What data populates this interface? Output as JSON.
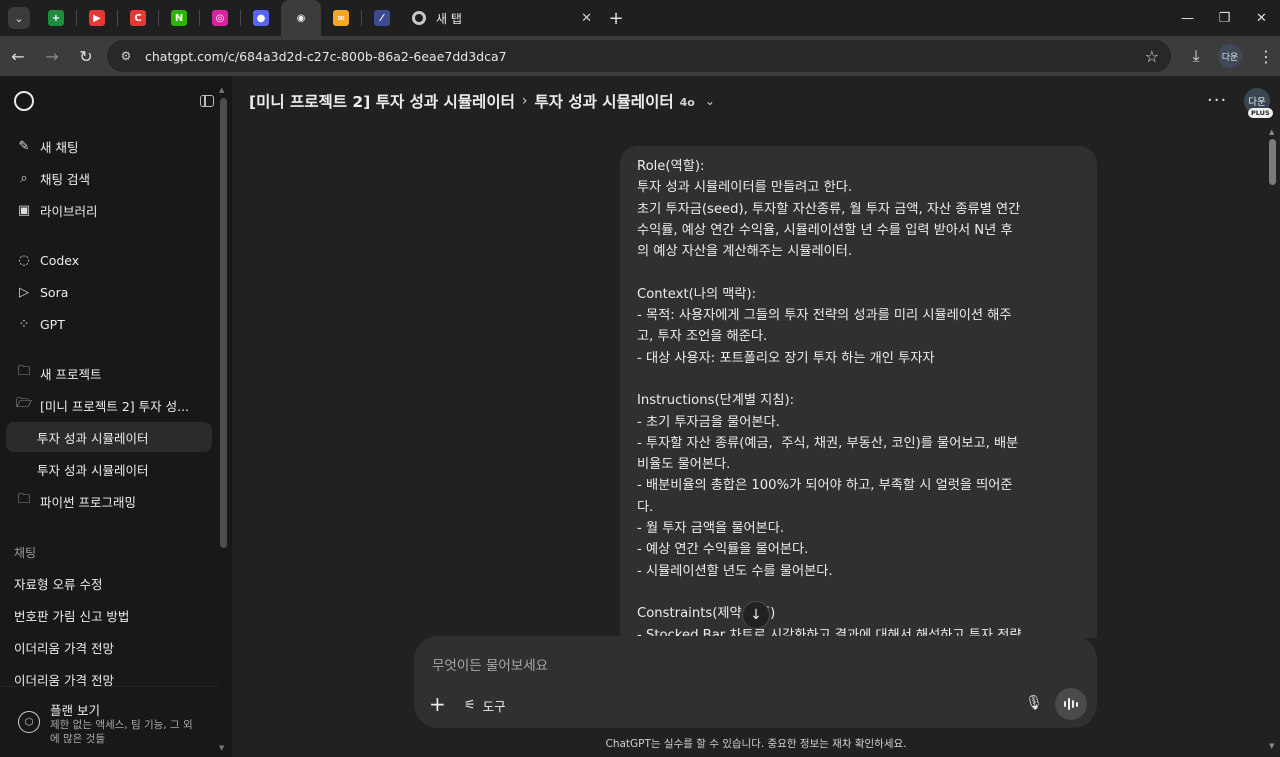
{
  "browser": {
    "tabs": [
      {
        "icon": "sheets-tab-icon",
        "glyph": "+",
        "color": "#1e8e3e"
      },
      {
        "icon": "youtube-tab-icon",
        "glyph": "▶",
        "color": "#e53935"
      },
      {
        "icon": "c-app-tab-icon",
        "glyph": "C",
        "color": "#e53935"
      },
      {
        "icon": "naver-tab-icon",
        "glyph": "N",
        "color": "#2db400"
      },
      {
        "icon": "instagram-tab-icon",
        "glyph": "◎",
        "color": "#d6249f"
      },
      {
        "icon": "discord-tab-icon",
        "glyph": "●",
        "color": "#5865f2"
      },
      {
        "icon": "chatgpt-tab-icon",
        "glyph": "◉",
        "color": "#3c3c3c"
      },
      {
        "icon": "infinity-tab-icon",
        "glyph": "∞",
        "color": "#f5a623"
      },
      {
        "icon": "feather-tab-icon",
        "glyph": "⁄",
        "color": "#3d4a8f"
      }
    ],
    "new_tab_title": "새 탭",
    "url": "chatgpt.com/c/684a3d2d-c27c-800b-86a2-6eae7dd3dca7",
    "profile_initials": "다운"
  },
  "sidebar": {
    "primary": [
      {
        "label": "새 채팅",
        "icon": "✎"
      },
      {
        "label": "채팅 검색",
        "icon": "⌕"
      },
      {
        "label": "라이브러리",
        "icon": "▣"
      }
    ],
    "apps": [
      {
        "label": "Codex",
        "icon": "◌"
      },
      {
        "label": "Sora",
        "icon": "▷"
      },
      {
        "label": "GPT",
        "icon": "⁘"
      }
    ],
    "projects": [
      {
        "label": "새 프로젝트",
        "icon": "🗀"
      },
      {
        "label": "[미니 프로젝트 2] 투자 성...",
        "icon": "🗁"
      }
    ],
    "project_chats": [
      "투자 성과 시뮬레이터",
      "투자 성과 시뮬레이터"
    ],
    "folder_python": "파이썬 프로그래밍",
    "chats_heading": "채팅",
    "chats": [
      "자료형 오류 수정",
      "번호판 가림 신고 방법",
      "이더리움 가격 전망",
      "이더리움 가격 전망"
    ],
    "plan": {
      "title": "플랜 보기",
      "subtitle": "제한 없는 액세스, 팀 기능, 그 외에 많은 것들"
    }
  },
  "header": {
    "project": "[미니 프로젝트 2] 투자 성과 시뮬레이터",
    "chat": "투자 성과 시뮬레이터",
    "model": "4o",
    "avatar_initials": "다운",
    "avatar_badge": "PLUS"
  },
  "message": {
    "lines": [
      "Role(역할):",
      "투자 성과 시뮬레이터를 만들려고 한다.",
      "초기 투자금(seed), 투자할 자산종류, 월 투자 금액, 자산 종류별 연간",
      "수익률, 예상 연간 수익율, 시뮬레이션할 년 수를 입력 받아서 N년 후",
      "의 예상 자산을 계산해주는 시뮬레이터.",
      "",
      "Context(나의 맥락):",
      "- 목적: 사용자에게 그들의 투자 전략의 성과를 미리 시뮬레이션 해주",
      "고, 투자 조언을 해준다.",
      "- 대상 사용자: 포트폴리오 장기 투자 하는 개인 투자자",
      "",
      "Instructions(단계별 지침):",
      "- 초기 투자금을 물어본다.",
      "- 투자할 자산 종류(예금,  주식, 채권, 부동산, 코인)를 물어보고, 배분",
      "비율도 물어본다.",
      "- 배분비율의 총합은 100%가 되어야 하고, 부족할 시 얼럿을 띄어준",
      "다.",
      "- 월 투자 금액을 물어본다.",
      "- 예상 연간 수익률을 물어본다.",
      "- 시뮬레이션할 년도 수를 물어본다.",
      "",
      "Constraints(제약 조건)",
      "- Stocked Bar 차트로 시각화하고 결과에 대해서 해석하고 투자 전략"
    ]
  },
  "composer": {
    "placeholder": "무엇이든 물어보세요",
    "tools_label": "도구"
  },
  "disclaimer": "ChatGPT는 실수를 할 수 있습니다. 중요한 정보는 재차 확인하세요."
}
